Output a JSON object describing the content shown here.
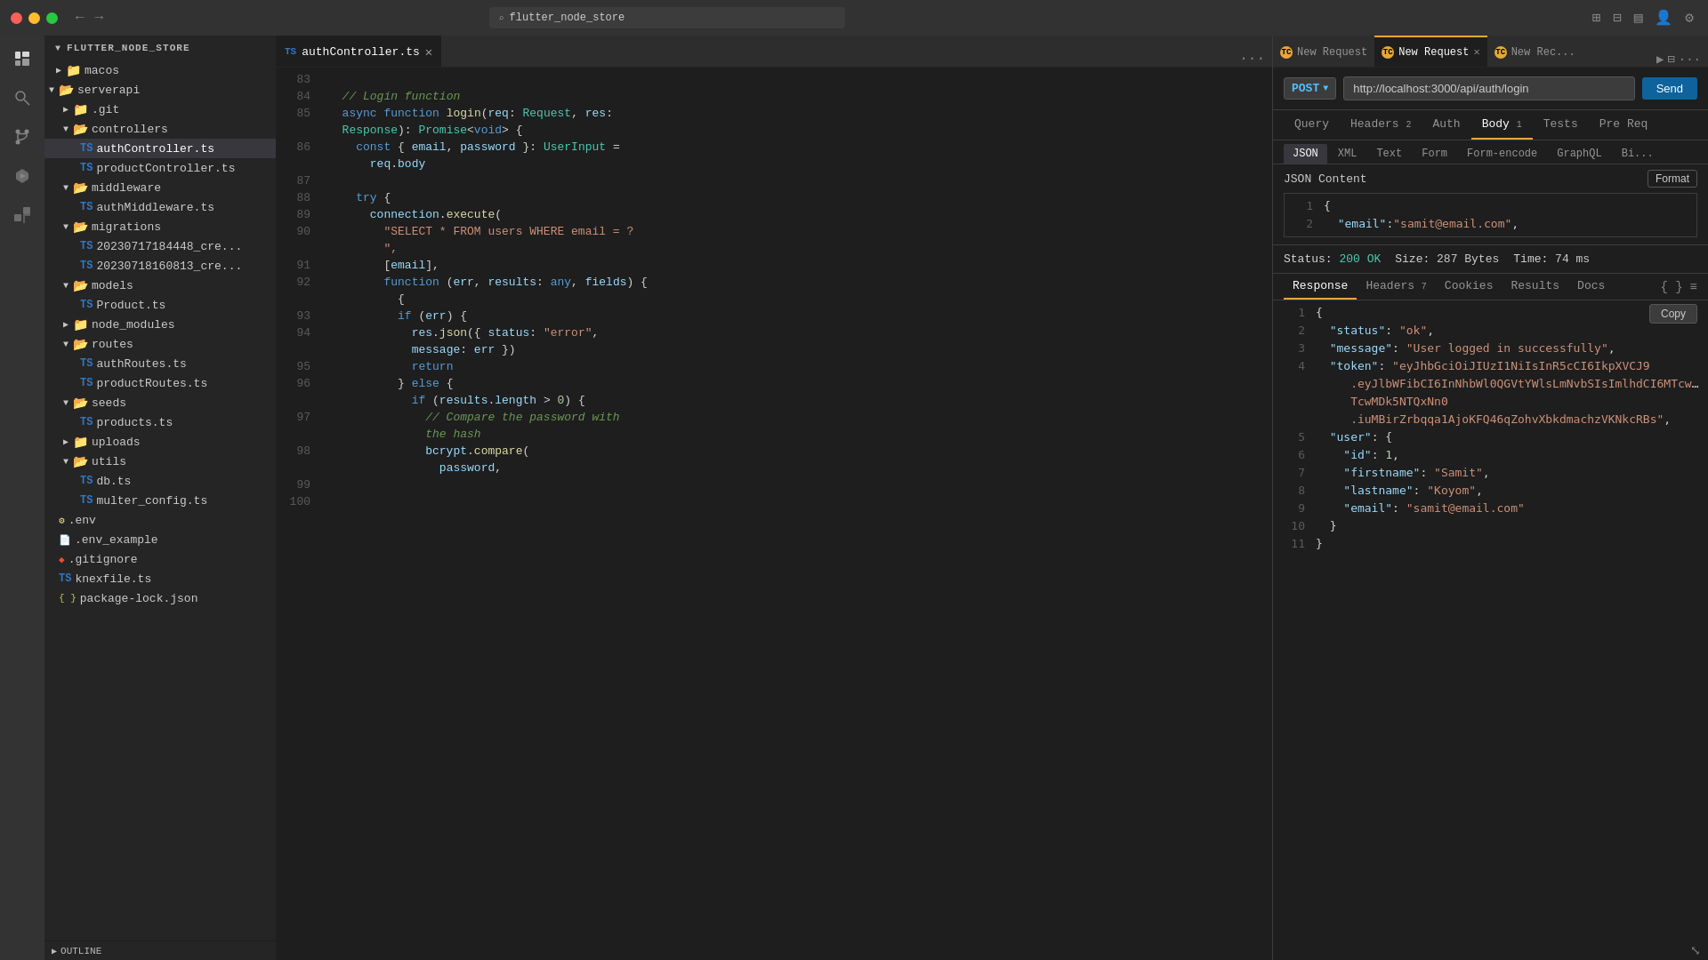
{
  "titlebar": {
    "search_placeholder": "flutter_node_store",
    "back_arrow": "←",
    "forward_arrow": "→"
  },
  "activity_bar": {
    "icons": [
      "explorer",
      "search",
      "source-control",
      "debug",
      "extensions"
    ]
  },
  "sidebar": {
    "header": "FLUTTER_NODE_STORE",
    "items": [
      {
        "id": "macos",
        "label": "macos",
        "type": "folder",
        "indent": 1,
        "expanded": false
      },
      {
        "id": "serverapi",
        "label": "serverapi",
        "type": "folder-open",
        "indent": 0,
        "expanded": true
      },
      {
        "id": "git",
        "label": ".git",
        "type": "folder",
        "indent": 1,
        "expanded": false
      },
      {
        "id": "controllers",
        "label": "controllers",
        "type": "folder-open",
        "indent": 1,
        "expanded": true
      },
      {
        "id": "authController",
        "label": "authController.ts",
        "type": "ts",
        "indent": 3,
        "active": true
      },
      {
        "id": "productController",
        "label": "productController.ts",
        "type": "ts",
        "indent": 3
      },
      {
        "id": "middleware",
        "label": "middleware",
        "type": "folder-open",
        "indent": 1,
        "expanded": true
      },
      {
        "id": "authMiddleware",
        "label": "authMiddleware.ts",
        "type": "ts",
        "indent": 3
      },
      {
        "id": "migrations",
        "label": "migrations",
        "type": "folder-open",
        "indent": 1,
        "expanded": true
      },
      {
        "id": "migration1",
        "label": "20230717184448_cre...",
        "type": "ts",
        "indent": 3
      },
      {
        "id": "migration2",
        "label": "20230718160813_cre...",
        "type": "ts",
        "indent": 3
      },
      {
        "id": "models",
        "label": "models",
        "type": "folder-open",
        "indent": 1,
        "expanded": true
      },
      {
        "id": "product",
        "label": "Product.ts",
        "type": "ts",
        "indent": 3
      },
      {
        "id": "node_modules",
        "label": "node_modules",
        "type": "folder",
        "indent": 1,
        "expanded": false
      },
      {
        "id": "routes",
        "label": "routes",
        "type": "folder-open",
        "indent": 1,
        "expanded": true
      },
      {
        "id": "authRoutes",
        "label": "authRoutes.ts",
        "type": "ts",
        "indent": 3
      },
      {
        "id": "productRoutes",
        "label": "productRoutes.ts",
        "type": "ts",
        "indent": 3
      },
      {
        "id": "seeds",
        "label": "seeds",
        "type": "folder-open",
        "indent": 1,
        "expanded": true
      },
      {
        "id": "products",
        "label": "products.ts",
        "type": "ts",
        "indent": 3
      },
      {
        "id": "uploads",
        "label": "uploads",
        "type": "folder",
        "indent": 1,
        "expanded": false
      },
      {
        "id": "utils",
        "label": "utils",
        "type": "folder-open",
        "indent": 1,
        "expanded": true
      },
      {
        "id": "db",
        "label": "db.ts",
        "type": "ts",
        "indent": 3
      },
      {
        "id": "multer_config",
        "label": "multer_config.ts",
        "type": "ts",
        "indent": 3
      },
      {
        "id": "env",
        "label": ".env",
        "type": "env",
        "indent": 1
      },
      {
        "id": "env_example",
        "label": ".env_example",
        "type": "env",
        "indent": 1
      },
      {
        "id": "gitignore",
        "label": ".gitignore",
        "type": "git",
        "indent": 1
      },
      {
        "id": "knexfile",
        "label": "knexfile.ts",
        "type": "ts",
        "indent": 1
      },
      {
        "id": "package_lock",
        "label": "package-lock.json",
        "type": "json",
        "indent": 1
      }
    ]
  },
  "editor": {
    "tab_label": "authController.ts",
    "lines": [
      {
        "num": "83",
        "content": ""
      },
      {
        "num": "84",
        "content": "  // Login function"
      },
      {
        "num": "85",
        "content": "  async function login(req: Request, res:"
      },
      {
        "num": "",
        "content": "  Response): Promise<void> {"
      },
      {
        "num": "86",
        "content": "    const { email, password }: UserInput ="
      },
      {
        "num": "",
        "content": "      req.body"
      },
      {
        "num": "87",
        "content": ""
      },
      {
        "num": "88",
        "content": "    try {"
      },
      {
        "num": "89",
        "content": "      connection.execute("
      },
      {
        "num": "90",
        "content": "        \"SELECT * FROM users WHERE email = ?\","
      },
      {
        "num": "91",
        "content": "        [email],"
      },
      {
        "num": "92",
        "content": "        function (err, results: any, fields) {"
      },
      {
        "num": "",
        "content": "          {"
      },
      {
        "num": "93",
        "content": "          if (err) {"
      },
      {
        "num": "94",
        "content": "            res.json({ status: \"error\","
      },
      {
        "num": "",
        "content": "            message: err })"
      },
      {
        "num": "95",
        "content": "            return"
      },
      {
        "num": "96",
        "content": "          } else {"
      },
      {
        "num": "",
        "content": "            if (results.length > 0) {"
      },
      {
        "num": "97",
        "content": "              // Compare the password with"
      },
      {
        "num": "",
        "content": "              the hash"
      },
      {
        "num": "98",
        "content": "              bcrypt.compare("
      },
      {
        "num": "",
        "content": "                password,"
      },
      {
        "num": "99",
        "content": ""
      },
      {
        "num": "100",
        "content": ""
      }
    ]
  },
  "thunder_client": {
    "tabs": [
      {
        "label": "New Request",
        "active": false,
        "badge": "TC"
      },
      {
        "label": "New Request",
        "active": true,
        "badge": "TC"
      },
      {
        "label": "New Rec...",
        "active": false,
        "badge": "TC"
      }
    ],
    "method": "POST",
    "url": "http://localhost:3000/api/auth/login",
    "send_label": "Send",
    "nav_items": [
      {
        "label": "Query",
        "active": false
      },
      {
        "label": "Headers",
        "active": false,
        "badge": "2"
      },
      {
        "label": "Auth",
        "active": false
      },
      {
        "label": "Body",
        "active": true,
        "badge": "1"
      },
      {
        "label": "Tests",
        "active": false
      },
      {
        "label": "Pre Req",
        "active": false
      }
    ],
    "body_types": [
      {
        "label": "JSON",
        "active": true
      },
      {
        "label": "XML",
        "active": false
      },
      {
        "label": "Text",
        "active": false
      },
      {
        "label": "Form",
        "active": false
      },
      {
        "label": "Form-encode",
        "active": false
      },
      {
        "label": "GraphQL",
        "active": false
      },
      {
        "label": "Bi...",
        "active": false
      }
    ],
    "json_content_label": "JSON Content",
    "format_label": "Format",
    "json_body": [
      {
        "num": 1,
        "content": "{"
      },
      {
        "num": 2,
        "content": "  \"email\":\"samit@email.com\","
      }
    ],
    "status": {
      "label": "Status:",
      "value": "200 OK",
      "size_label": "Size:",
      "size_value": "287 Bytes",
      "time_label": "Time:",
      "time_value": "74 ms"
    },
    "response_tabs": [
      {
        "label": "Response",
        "active": true
      },
      {
        "label": "Headers",
        "active": false,
        "badge": "7"
      },
      {
        "label": "Cookies",
        "active": false
      },
      {
        "label": "Results",
        "active": false
      },
      {
        "label": "Docs",
        "active": false
      }
    ],
    "copy_label": "Copy",
    "response_lines": [
      {
        "num": 1,
        "content": "{"
      },
      {
        "num": 2,
        "content": "  \"status\": \"ok\","
      },
      {
        "num": 3,
        "content": "  \"message\": \"User logged in successfully\","
      },
      {
        "num": 4,
        "content": "  \"token\": \"eyJhbGciOiJIUzI1NiIsInR5cCI6IkpXVCJ9.eyJlbWFibCI6InNhbWl0QGVtYWlsLmNvbSIsImlhdCI6MTcwNGMDk5NTQxNn0.iuMBirZrbqqa1AjoKFQ46qZohvXbkdmachzVKNkc...\",",
        "long": true
      },
      {
        "num": 5,
        "content": "  \"user\": {"
      },
      {
        "num": 6,
        "content": "    \"id\": 1,"
      },
      {
        "num": 7,
        "content": "    \"firstname\": \"Samit\","
      },
      {
        "num": 8,
        "content": "    \"lastname\": \"Koyom\","
      },
      {
        "num": 9,
        "content": "    \"email\": \"samit@email.com\""
      },
      {
        "num": 10,
        "content": "  }"
      },
      {
        "num": 11,
        "content": "}"
      }
    ]
  },
  "bottom": {
    "outline_label": "OUTLINE"
  }
}
